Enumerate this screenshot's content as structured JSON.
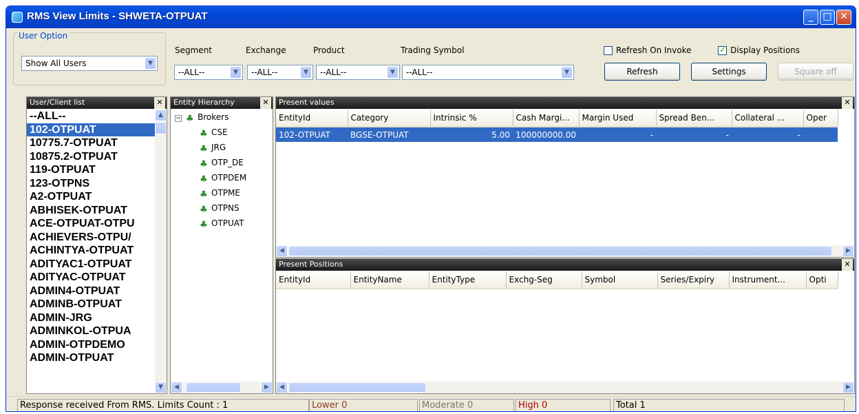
{
  "window": {
    "title": "RMS View Limits - SHWETA-OTPUAT",
    "minimize": "_",
    "maximize": "□",
    "close": "✕"
  },
  "toolbar": {
    "user_option_label": "User Option",
    "user_option_value": "Show All Users",
    "segment_label": "Segment",
    "exchange_label": "Exchange",
    "product_label": "Product",
    "trading_symbol_label": "Trading Symbol",
    "segment_value": "--ALL--",
    "exchange_value": "--ALL--",
    "product_value": "--ALL--",
    "trading_symbol_value": "--ALL--",
    "refresh_on_invoke_label": "Refresh On Invoke",
    "display_positions_label": "Display Positions",
    "refresh_button": "Refresh",
    "settings_button": "Settings",
    "square_off_button": "Square off"
  },
  "user_list": {
    "title": "User/Client list",
    "items": [
      "--ALL--",
      "102-OTPUAT",
      "10775.7-OTPUAT",
      "10875.2-OTPUAT",
      "119-OTPUAT",
      "123-OTPNS",
      "A2-OTPUAT",
      "ABHISEK-OTPUAT",
      "ACE-OTPUAT-OTPU",
      "ACHIEVERS-OTPU/",
      "ACHINTYA-OTPUAT",
      "ADITYAC1-OTPUAT",
      "ADITYAC-OTPUAT",
      "ADMIN4-OTPUAT",
      "ADMINB-OTPUAT",
      "ADMIN-JRG",
      "ADMINKOL-OTPUA",
      "ADMIN-OTPDEMO",
      "ADMIN-OTPUAT"
    ],
    "selected_index": 1
  },
  "entity_hierarchy": {
    "title": "Entity Hierarchy",
    "root": "Brokers",
    "children": [
      "CSE",
      "JRG",
      "OTP_DE",
      "OTPDEM",
      "OTPME",
      "OTPNS",
      "OTPUAT"
    ]
  },
  "present_values": {
    "title": "Present values",
    "columns": [
      "EntityId",
      "Category",
      "Intrinsic %",
      "Cash Margi...",
      "Margin Used",
      "Spread Ben...",
      "Collateral ...",
      "Oper"
    ],
    "rows": [
      [
        "102-OTPUAT",
        "BGSE-OTPUAT",
        "5.00",
        "100000000.00",
        "-",
        "-",
        "-",
        ""
      ]
    ]
  },
  "present_positions": {
    "title": "Present Positions",
    "columns": [
      "EntityId",
      "EntityName",
      "EntityType",
      "Exchg-Seg",
      "Symbol",
      "Series/Expiry",
      "Instrument...",
      "Opti"
    ]
  },
  "status": {
    "message": "Response received From RMS. Limits Count : 1",
    "lower": "Lower 0",
    "moderate": "Moderate 0",
    "high": "High 0",
    "total": "Total 1"
  },
  "colors": {
    "title_bar": "#0a5ae6",
    "selection": "#316ac5",
    "lower": "#8b3a2b",
    "high": "#b00000"
  }
}
